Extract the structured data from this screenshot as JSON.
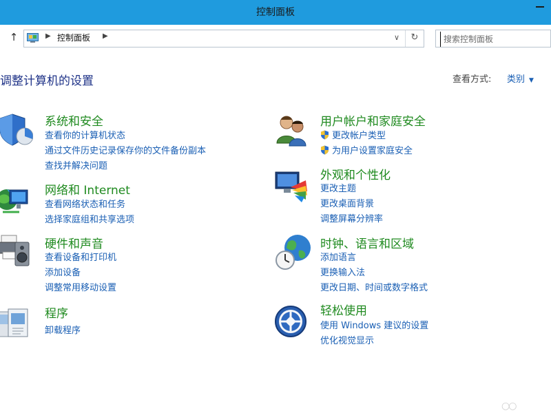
{
  "window": {
    "title": "控制面板"
  },
  "address": {
    "breadcrumb": "控制面板",
    "search_placeholder": "搜索控制面板"
  },
  "header": {
    "title": "调整计算机的设置",
    "view_by_label": "查看方式:",
    "view_by_value": "类别"
  },
  "categories": [
    {
      "title": "系统和安全",
      "icon": "shield-icon",
      "links": [
        "查看你的计算机状态",
        "通过文件历史记录保存你的文件备份副本",
        "查找并解决问题"
      ]
    },
    {
      "title": "网络和 Internet",
      "icon": "network-globe-icon",
      "links": [
        "查看网络状态和任务",
        "选择家庭组和共享选项"
      ]
    },
    {
      "title": "硬件和声音",
      "icon": "printer-speaker-icon",
      "links": [
        "查看设备和打印机",
        "添加设备",
        "调整常用移动设置"
      ]
    },
    {
      "title": "程序",
      "icon": "programs-icon",
      "links": [
        "卸载程序"
      ]
    },
    {
      "title": "用户帐户和家庭安全",
      "icon": "users-icon",
      "links": [
        "更改帐户类型",
        "为用户设置家庭安全"
      ]
    },
    {
      "title": "外观和个性化",
      "icon": "monitor-palette-icon",
      "links": [
        "更改主题",
        "更改桌面背景",
        "调整屏幕分辨率"
      ]
    },
    {
      "title": "时钟、语言和区域",
      "icon": "clock-globe-icon",
      "links": [
        "添加语言",
        "更换输入法",
        "更改日期、时间或数字格式"
      ]
    },
    {
      "title": "轻松使用",
      "icon": "ease-of-access-icon",
      "links": [
        "使用 Windows 建议的设置",
        "优化视觉显示"
      ]
    }
  ],
  "colors": {
    "titlebar": "#1f9bde",
    "heading": "#1e3287",
    "category": "#1f8a1f",
    "link": "#1a5fb4"
  }
}
